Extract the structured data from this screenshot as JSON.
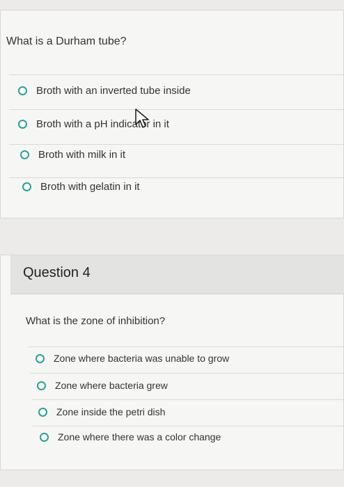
{
  "question3": {
    "prompt": "What is a Durham tube?",
    "options": [
      {
        "label": "Broth with an inverted tube inside"
      },
      {
        "label": "Broth with a pH indicator in it"
      },
      {
        "label": "Broth with milk in it"
      },
      {
        "label": "Broth with gelatin in it"
      }
    ]
  },
  "question4": {
    "title": "Question 4",
    "prompt": "What is the zone of inhibition?",
    "options": [
      {
        "label": "Zone where bacteria was unable to grow"
      },
      {
        "label": "Zone where bacteria grew"
      },
      {
        "label": "Zone inside the petri dish"
      },
      {
        "label": "Zone where there was a color change"
      }
    ]
  },
  "colors": {
    "radio_border": "#2aa18d"
  },
  "icons": {
    "cursor": "mouse-pointer-icon"
  }
}
